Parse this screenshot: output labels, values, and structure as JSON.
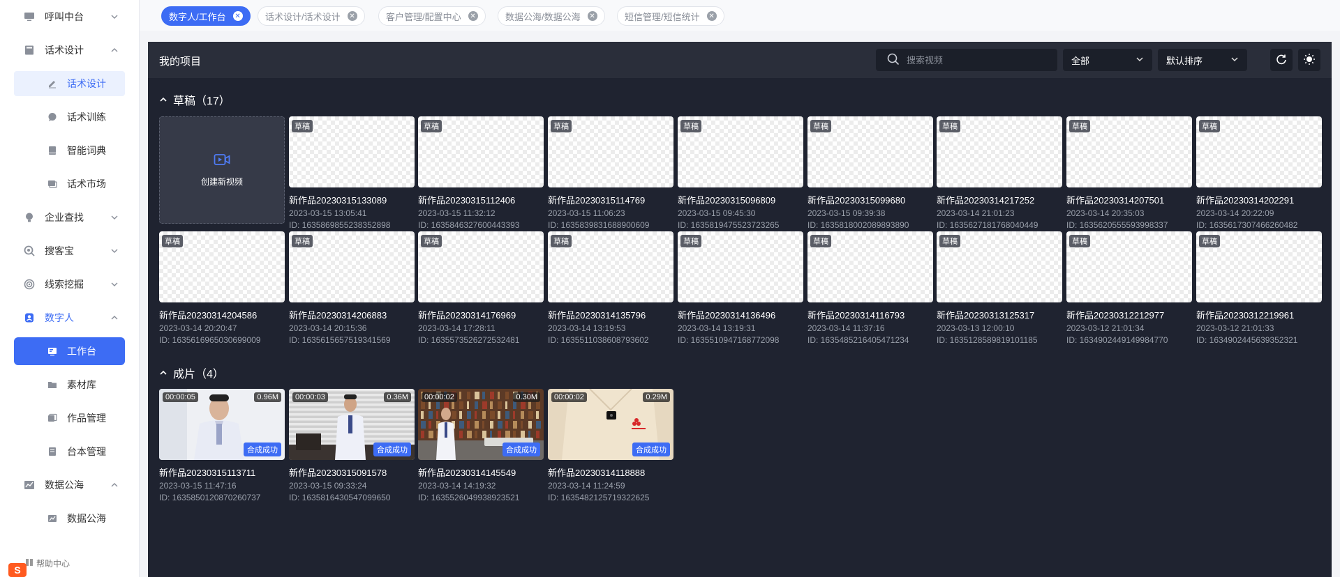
{
  "sidebar": {
    "groups": [
      {
        "label": "呼叫中台",
        "icon": "monitor-icon",
        "expanded": false
      },
      {
        "label": "话术设计",
        "icon": "book-icon",
        "expanded": true,
        "items": [
          {
            "label": "话术设计",
            "icon": "edit-icon"
          },
          {
            "label": "话术训练",
            "icon": "chat-icon"
          },
          {
            "label": "智能词典",
            "icon": "dictionary-icon"
          },
          {
            "label": "话术市场",
            "icon": "market-icon"
          }
        ]
      },
      {
        "label": "企业查找",
        "icon": "bulb-icon",
        "expanded": false
      },
      {
        "label": "搜客宝",
        "icon": "search-treasure-icon",
        "expanded": false
      },
      {
        "label": "线索挖掘",
        "icon": "target-icon",
        "expanded": false
      },
      {
        "label": "数字人",
        "icon": "digital-human-icon",
        "expanded": true,
        "items": [
          {
            "label": "工作台",
            "icon": "workbench-icon"
          },
          {
            "label": "素材库",
            "icon": "folder-icon"
          },
          {
            "label": "作品管理",
            "icon": "works-icon"
          },
          {
            "label": "台本管理",
            "icon": "script-icon"
          }
        ]
      },
      {
        "label": "数据公海",
        "icon": "chart-line-icon",
        "expanded": true,
        "items": [
          {
            "label": "数据公海",
            "icon": "data-icon"
          }
        ]
      }
    ],
    "help_label": "帮助中心"
  },
  "tabs": [
    {
      "label": "数字人/工作台",
      "active": true
    },
    {
      "label": "话术设计/话术设计",
      "active": false
    },
    {
      "label": "客户管理/配置中心",
      "active": false
    },
    {
      "label": "数据公海/数据公海",
      "active": false
    },
    {
      "label": "短信管理/短信统计",
      "active": false
    }
  ],
  "header": {
    "title": "我的项目",
    "search_placeholder": "搜索视频",
    "filter_value": "全部",
    "sort_value": "默认排序"
  },
  "drafts": {
    "title": "草稿（17）",
    "create_label": "创建新视频",
    "badge": "草稿",
    "items": [
      {
        "name": "新作品20230315133089",
        "date": "2023-03-15 13:05:41",
        "id": "ID:  1635869855238352898"
      },
      {
        "name": "新作品20230315112406",
        "date": "2023-03-15 11:32:12",
        "id": "ID:  1635846327600443393"
      },
      {
        "name": "新作品20230315114769",
        "date": "2023-03-15 11:06:23",
        "id": "ID:  1635839831688900609"
      },
      {
        "name": "新作品20230315096809",
        "date": "2023-03-15 09:45:30",
        "id": "ID:  1635819475523723265"
      },
      {
        "name": "新作品20230315099680",
        "date": "2023-03-15 09:39:38",
        "id": "ID:  1635818002089893890"
      },
      {
        "name": "新作品20230314217252",
        "date": "2023-03-14 21:01:23",
        "id": "ID:  1635627181768040449"
      },
      {
        "name": "新作品20230314207501",
        "date": "2023-03-14 20:35:03",
        "id": "ID:  1635620555593998337"
      },
      {
        "name": "新作品20230314202291",
        "date": "2023-03-14 20:22:09",
        "id": "ID:  1635617307466260482"
      },
      {
        "name": "新作品20230314204586",
        "date": "2023-03-14 20:20:47",
        "id": "ID:  1635616965030699009"
      },
      {
        "name": "新作品20230314206883",
        "date": "2023-03-14 20:15:36",
        "id": "ID:  1635615657519341569"
      },
      {
        "name": "新作品20230314176969",
        "date": "2023-03-14 17:28:11",
        "id": "ID:  1635573526272532481"
      },
      {
        "name": "新作品20230314135796",
        "date": "2023-03-14 13:19:53",
        "id": "ID:  1635511038608793602"
      },
      {
        "name": "新作品20230314136496",
        "date": "2023-03-14 13:19:31",
        "id": "ID:  1635510947168772098"
      },
      {
        "name": "新作品20230314116793",
        "date": "2023-03-14 11:37:16",
        "id": "ID:  1635485216405471234"
      },
      {
        "name": "新作品20230313125317",
        "date": "2023-03-13 12:00:10",
        "id": "ID:  1635128589819101185"
      },
      {
        "name": "新作品20230312212977",
        "date": "2023-03-12 21:01:34",
        "id": "ID:  1634902449149984770"
      },
      {
        "name": "新作品20230312219961",
        "date": "2023-03-12 21:01:33",
        "id": "ID:  1634902445639352321"
      }
    ]
  },
  "finished": {
    "title": "成片（4）",
    "status_label": "合成成功",
    "items": [
      {
        "name": "新作品20230315113711",
        "date": "2023-03-15 11:47:16",
        "id": "ID:  1635850120870260737",
        "duration": "00:00:05",
        "size": "0.96M",
        "scene": "white-room"
      },
      {
        "name": "新作品20230315091578",
        "date": "2023-03-15 09:33:24",
        "id": "ID:  1635816430547099650",
        "duration": "00:00:03",
        "size": "0.36M",
        "scene": "office-blinds"
      },
      {
        "name": "新作品20230314145549",
        "date": "2023-03-14 14:19:32",
        "id": "ID:  1635526049938923521",
        "duration": "00:00:02",
        "size": "0.30M",
        "scene": "library"
      },
      {
        "name": "新作品20230314118888",
        "date": "2023-03-14 11:24:59",
        "id": "ID:  1635482125719322625",
        "duration": "00:00:02",
        "size": "0.29M",
        "scene": "close-up"
      }
    ]
  },
  "colors": {
    "accent": "#3d6cf4",
    "panel": "#1f2330",
    "header": "#2a2e3a"
  }
}
